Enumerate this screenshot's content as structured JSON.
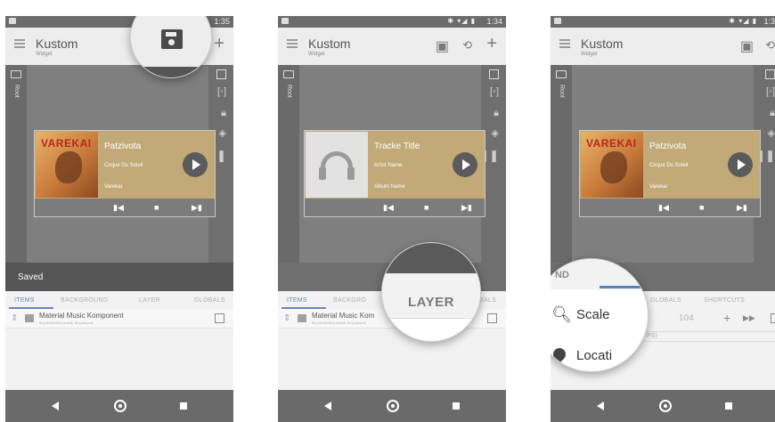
{
  "panels": [
    {
      "status_time": "1:35",
      "app_title": "Kustom",
      "app_subtitle": "Widget",
      "root_label": "Root",
      "track_title": "Patzivota",
      "track_artist": "Cirque Du Soleil",
      "track_album": "Varekai",
      "album_logo": "VAREKAI",
      "snackbar": "Saved",
      "tabs": [
        "ITEMS",
        "BACKGROUND",
        "LAYER",
        "GLOBALS"
      ],
      "item_name": "Material Music Komponent",
      "item_desc": "$mj:title$\\n$mj:artist$, $mj:album$"
    },
    {
      "status_time": "1:34",
      "app_title": "Kustom",
      "app_subtitle": "Widget",
      "root_label": "Root",
      "track_title": "Tracke Title",
      "track_artist": "Artist Name",
      "track_album": "Album Name",
      "tabs": [
        "ITEMS",
        "BACKGRO",
        "LAYER",
        "BALS"
      ],
      "item_name": "Material Music Kom",
      "item_desc": "$mj:title$\\n$mj:artist$, $mj:album$"
    },
    {
      "status_time": "1:3",
      "app_title": "Kustom",
      "app_subtitle": "Widget",
      "root_label": "Root",
      "track_title": "Patzivota",
      "track_artist": "Cirque Du Soleil",
      "track_album": "Varekai",
      "album_logo": "VAREKAI",
      "tabs": [
        "ND",
        "GLOBALS",
        "SHORTCUTS"
      ],
      "scale_value": "104",
      "gps_partial": "PS)"
    }
  ],
  "magnifiers": {
    "one": {
      "icon": "save-icon"
    },
    "two": {
      "label": "LAYER"
    },
    "three": {
      "tab_partial": "ND",
      "item1": "Scale",
      "item2": "Locati"
    }
  },
  "colors": {
    "accent": "#6d86b8",
    "card": "#c2aa78",
    "navbar": "#6a6a6a"
  }
}
